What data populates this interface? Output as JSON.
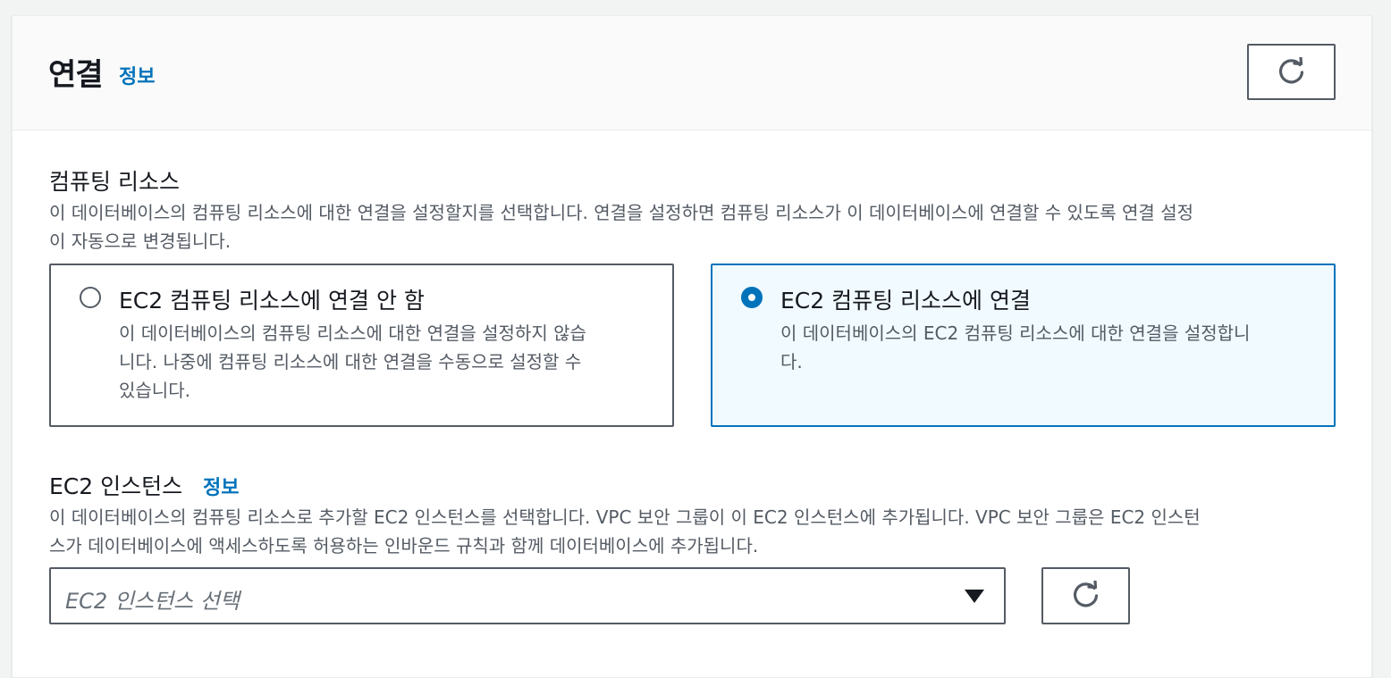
{
  "header": {
    "title": "연결",
    "info_label": "정보",
    "refresh_icon": "refresh-icon"
  },
  "compute": {
    "label": "컴퓨팅 리소스",
    "description_line1": "이 데이터베이스의 컴퓨팅 리소스에 대한 연결을 설정할지를 선택합니다. 연결을 설정하면 컴퓨팅 리소스가 이 데이터베이스에 연결할 수 있도록 연결 설정",
    "description_line2": "이 자동으로 변경됩니다.",
    "options": [
      {
        "title": "EC2 컴퓨팅 리소스에 연결 안 함",
        "desc_line1": "이 데이터베이스의 컴퓨팅 리소스에 대한 연결을 설정하지 않습",
        "desc_line2": "니다. 나중에 컴퓨팅 리소스에 대한 연결을 수동으로 설정할 수",
        "desc_line3": "있습니다.",
        "selected": false
      },
      {
        "title": "EC2 컴퓨팅 리소스에 연결",
        "desc_line1": "이 데이터베이스의 EC2 컴퓨팅 리소스에 대한 연결을 설정합니",
        "desc_line2": "다.",
        "selected": true
      }
    ]
  },
  "instance": {
    "label": "EC2 인스턴스",
    "info_label": "정보",
    "description_line1": "이 데이터베이스의 컴퓨팅 리소스로 추가할 EC2 인스턴스를 선택합니다. VPC 보안 그룹이 이 EC2 인스턴스에 추가됩니다. VPC 보안 그룹은 EC2 인스턴",
    "description_line2": "스가 데이터베이스에 액세스하도록 허용하는 인바운드 규칙과 함께 데이터베이스에 추가됩니다.",
    "select_placeholder": "EC2 인스턴스 선택"
  },
  "colors": {
    "accent": "#0073bb",
    "border": "#545b64",
    "selected_bg": "#f1faff"
  }
}
